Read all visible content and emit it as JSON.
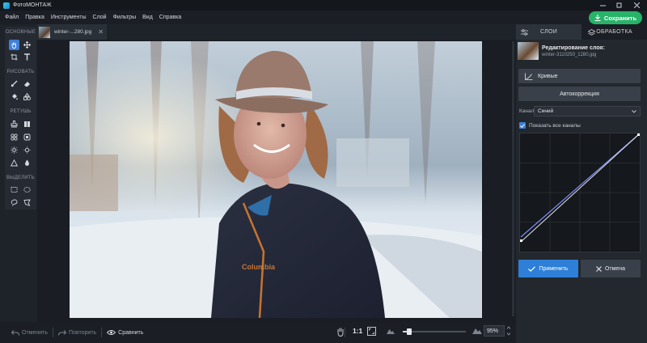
{
  "app": {
    "title": "ФотоМОНТАЖ"
  },
  "menu": [
    "Файл",
    "Правка",
    "Инструменты",
    "Слой",
    "Фильтры",
    "Вид",
    "Справка"
  ],
  "save_button": "Сохранить",
  "tools": {
    "sections": [
      "ОСНОВНЫЕ",
      "РИСОВАТЬ",
      "РЕТУШЬ",
      "ВЫДЕЛИТЬ"
    ]
  },
  "document_tab": {
    "name": "winter-...280.jpg",
    "close": "✕"
  },
  "bottom_bar": {
    "undo": "Отменить",
    "redo": "Повторить",
    "compare": "Сравнить",
    "ratio": "1:1",
    "zoom": "95%",
    "zoom_level": 0.1
  },
  "right_panel": {
    "tabs": [
      "СЛОИ",
      "ОБРАБОТКА"
    ],
    "layer": {
      "title": "Редактирование слоя:",
      "file": "winter-3110250_1280.jpg"
    },
    "curves_button": "Кривые",
    "autocorrect_button": "Автокоррекция",
    "channel": {
      "label": "Канал",
      "value": "Синий"
    },
    "show_all_channels": "Показать все каналы",
    "apply_button": "Применить",
    "cancel_button": "Отмена"
  },
  "colors": {
    "accent": "#2d7fd8",
    "save": "#27b36a",
    "panel": "#23282f",
    "curve_blue": "#7f8cff",
    "curve_white": "#e6e6e6"
  }
}
